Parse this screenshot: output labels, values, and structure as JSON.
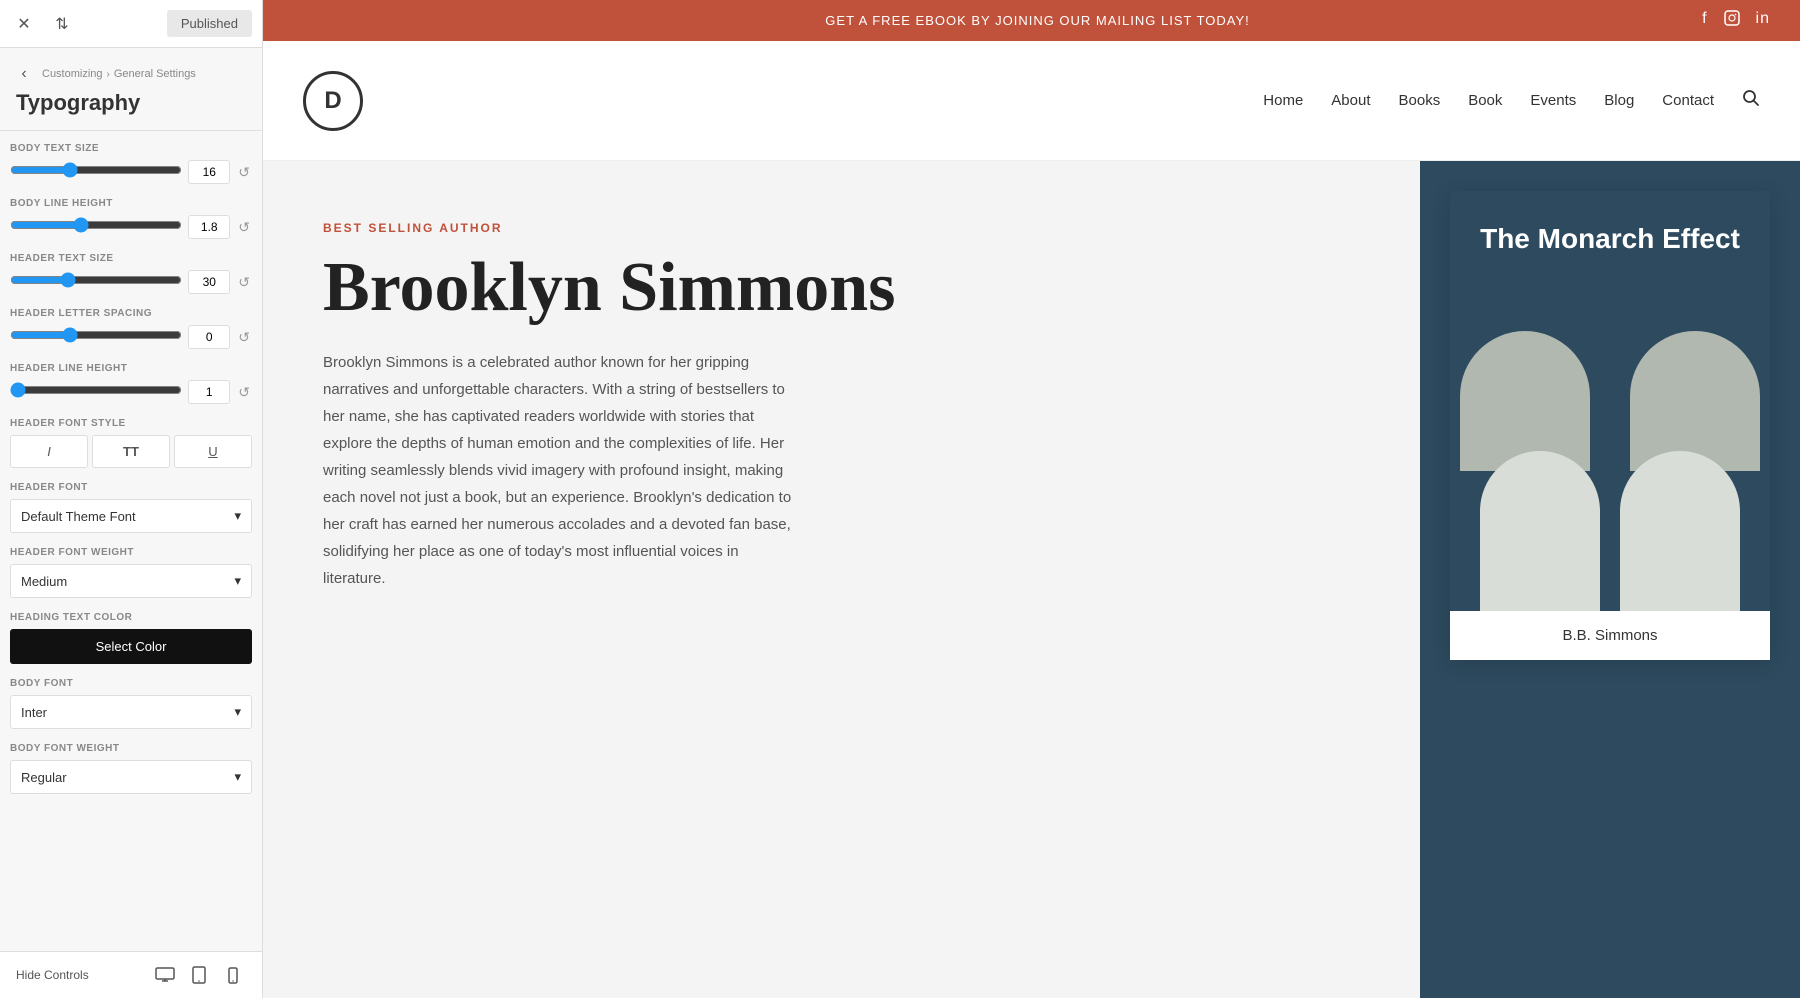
{
  "topbar": {
    "published_label": "Published",
    "swap_icon": "⇅",
    "close_icon": "✕"
  },
  "breadcrumb": {
    "parent": "Customizing",
    "arrow": "›",
    "child": "General Settings"
  },
  "panel_title": "Typography",
  "fields": {
    "body_text_size": {
      "label": "BODY TEXT SIZE",
      "value": "16",
      "min": 8,
      "max": 32,
      "current": 16
    },
    "body_line_height": {
      "label": "BODY LINE HEIGHT",
      "value": "1.8",
      "min": 1,
      "max": 3,
      "current": 1.8
    },
    "header_text_size": {
      "label": "HEADER TEXT SIZE",
      "value": "30",
      "min": 10,
      "max": 72,
      "current": 30
    },
    "header_letter_spacing": {
      "label": "HEADER LETTER SPACING",
      "value": "0",
      "min": -5,
      "max": 10,
      "current": 0
    },
    "header_line_height": {
      "label": "HEADER LINE HEIGHT",
      "value": "1",
      "min": 1,
      "max": 3,
      "current": 1
    },
    "header_font_style": {
      "label": "HEADER FONT STYLE",
      "italic": "I",
      "bold": "TT",
      "underline": "U"
    },
    "header_font": {
      "label": "HEADER FONT",
      "selected": "Default Theme Font"
    },
    "header_font_weight": {
      "label": "HEADER FONT WEIGHT",
      "selected": "Medium"
    },
    "heading_text_color": {
      "label": "HEADING TEXT COLOR",
      "button_label": "Select Color"
    },
    "body_font": {
      "label": "BODY FONT",
      "selected": "Inter"
    },
    "body_font_weight": {
      "label": "BODY FONT WEIGHT",
      "selected": "Regular"
    }
  },
  "bottombar": {
    "hide_label": "Hide Controls",
    "desktop_icon": "🖥",
    "tablet_icon": "📱",
    "mobile_icon": "📲"
  },
  "preview": {
    "topbar_text": "GET A FREE EBOOK BY JOINING OUR MAILING LIST TODAY!",
    "social": [
      "f",
      "in",
      "li"
    ],
    "nav": {
      "logo_letter": "D",
      "links": [
        "Home",
        "About",
        "Books",
        "Book",
        "Events",
        "Blog",
        "Contact"
      ]
    },
    "hero": {
      "tag": "BEST SELLING AUTHOR",
      "title": "Brooklyn Simmons",
      "description": "Brooklyn Simmons is a celebrated author known for her gripping narratives and unforgettable characters. With a string of bestsellers to her name, she has captivated readers worldwide with stories that explore the depths of human emotion and the complexities of life. Her writing seamlessly blends vivid imagery with profound insight, making each novel not just a book, but an experience. Brooklyn's dedication to her craft has earned her numerous accolades and a devoted fan base, solidifying her place as one of today's most influential voices in literature."
    },
    "book": {
      "title": "The Monarch Effect",
      "author": "B.B. Simmons"
    }
  }
}
